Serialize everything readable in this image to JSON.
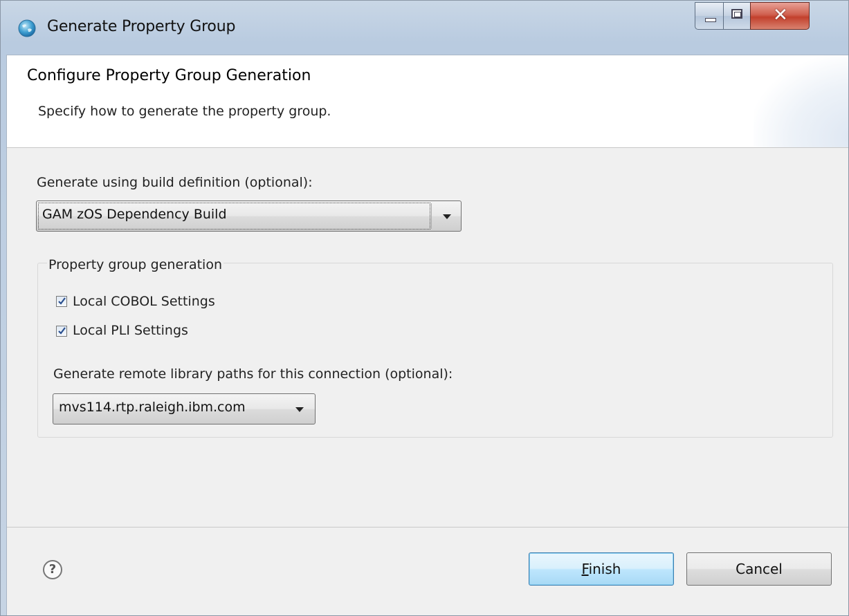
{
  "window": {
    "title": "Generate Property Group",
    "icon": "globe-icon",
    "controls": [
      "minimize",
      "maximize",
      "close"
    ]
  },
  "header": {
    "title": "Configure Property Group Generation",
    "description": "Specify how to generate the property group."
  },
  "build_definition": {
    "label": "Generate using build definition (optional):",
    "selected": "GAM zOS Dependency Build"
  },
  "property_group_generation": {
    "legend": "Property group generation",
    "options": [
      {
        "label": "Local COBOL Settings",
        "checked": true
      },
      {
        "label": "Local PLI Settings",
        "checked": true
      }
    ],
    "remote_paths_label": "Generate remote library paths for this connection (optional):",
    "connection_selected": "mvs114.rtp.raleigh.ibm.com"
  },
  "footer": {
    "help_icon": "help-icon",
    "help_glyph": "?",
    "finish_mnemonic": "F",
    "finish_rest": "inish",
    "cancel_label": "Cancel"
  },
  "colors": {
    "finish_border": "#3c7fb1",
    "close_button": "#c2402d",
    "title_bar": "#b9cbe0"
  }
}
